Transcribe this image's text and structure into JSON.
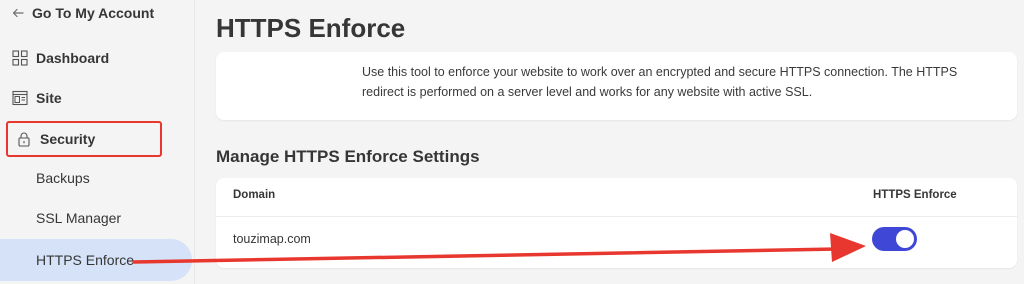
{
  "sidebar": {
    "back_label": "Go To My Account",
    "items": [
      {
        "label": "Dashboard",
        "icon": "grid-icon"
      },
      {
        "label": "Site",
        "icon": "layout-icon"
      },
      {
        "label": "Security",
        "icon": "lock-icon",
        "highlighted": true
      }
    ],
    "sub_items": [
      {
        "label": "Backups"
      },
      {
        "label": "SSL Manager"
      },
      {
        "label": "HTTPS Enforce",
        "active": true
      }
    ]
  },
  "main": {
    "title": "HTTPS Enforce",
    "intro": "Use this tool to enforce your website to work over an encrypted and secure HTTPS connection. The HTTPS redirect is performed on a server level and works for any website with active SSL.",
    "section_title": "Manage HTTPS Enforce Settings",
    "table": {
      "columns": [
        "Domain",
        "HTTPS Enforce"
      ],
      "rows": [
        {
          "domain": "touzimap.com",
          "https_enforce": true
        }
      ]
    }
  },
  "colors": {
    "highlight_border": "#e8372e",
    "annotation_arrow": "#e8372e",
    "active_nav_bg": "#d5e2f7",
    "toggle_on": "#3f48d6"
  }
}
